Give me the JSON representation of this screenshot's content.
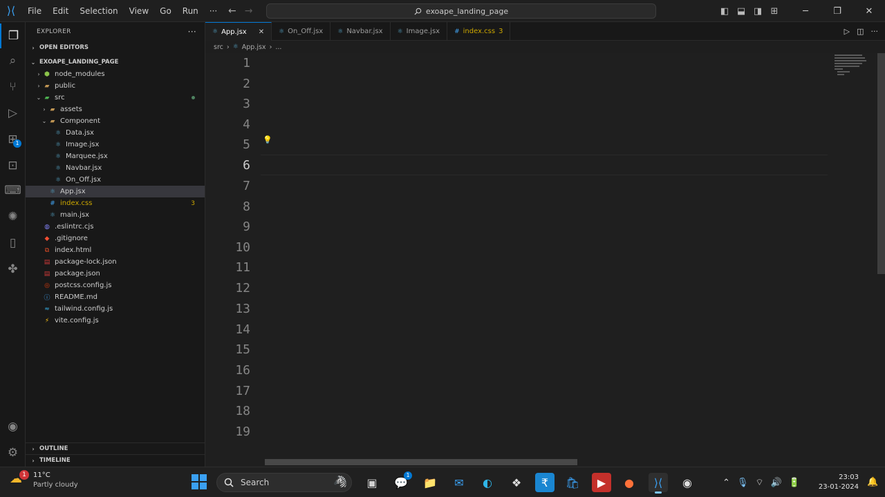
{
  "menu": [
    "File",
    "Edit",
    "Selection",
    "View",
    "Go",
    "Run",
    "···"
  ],
  "command_center": "exoape_landing_page",
  "explorer": {
    "title": "EXPLORER",
    "open_editors": "OPEN EDITORS",
    "project": "EXOAPE_LANDING_PAGE",
    "tree": [
      {
        "label": "node_modules",
        "depth": 1,
        "kind": "folder",
        "twisty": "›",
        "icon": "node"
      },
      {
        "label": "public",
        "depth": 1,
        "kind": "folder",
        "twisty": "›",
        "icon": "folder"
      },
      {
        "label": "src",
        "depth": 1,
        "kind": "folder",
        "twisty": "⌄",
        "icon": "folder-src",
        "modified": true
      },
      {
        "label": "assets",
        "depth": 2,
        "kind": "folder",
        "twisty": "›",
        "icon": "folder"
      },
      {
        "label": "Component",
        "depth": 2,
        "kind": "folder",
        "twisty": "⌄",
        "icon": "folder"
      },
      {
        "label": "Data.jsx",
        "depth": 3,
        "kind": "file",
        "icon": "jsx"
      },
      {
        "label": "Image.jsx",
        "depth": 3,
        "kind": "file",
        "icon": "jsx"
      },
      {
        "label": "Marquee.jsx",
        "depth": 3,
        "kind": "file",
        "icon": "jsx"
      },
      {
        "label": "Navbar.jsx",
        "depth": 3,
        "kind": "file",
        "icon": "jsx"
      },
      {
        "label": "On_Off.jsx",
        "depth": 3,
        "kind": "file",
        "icon": "jsx"
      },
      {
        "label": "App.jsx",
        "depth": 2,
        "kind": "file",
        "icon": "jsx",
        "selected": true
      },
      {
        "label": "index.css",
        "depth": 2,
        "kind": "file",
        "icon": "css",
        "badge": "3",
        "warn": true
      },
      {
        "label": "main.jsx",
        "depth": 2,
        "kind": "file",
        "icon": "jsx"
      },
      {
        "label": ".eslintrc.cjs",
        "depth": 1,
        "kind": "file",
        "icon": "eslint"
      },
      {
        "label": ".gitignore",
        "depth": 1,
        "kind": "file",
        "icon": "git"
      },
      {
        "label": "index.html",
        "depth": 1,
        "kind": "file",
        "icon": "html"
      },
      {
        "label": "package-lock.json",
        "depth": 1,
        "kind": "file",
        "icon": "npm"
      },
      {
        "label": "package.json",
        "depth": 1,
        "kind": "file",
        "icon": "npm"
      },
      {
        "label": "postcss.config.js",
        "depth": 1,
        "kind": "file",
        "icon": "postcss"
      },
      {
        "label": "README.md",
        "depth": 1,
        "kind": "file",
        "icon": "info"
      },
      {
        "label": "tailwind.config.js",
        "depth": 1,
        "kind": "file",
        "icon": "tailwind"
      },
      {
        "label": "vite.config.js",
        "depth": 1,
        "kind": "file",
        "icon": "vite"
      }
    ],
    "outline": "OUTLINE",
    "timeline": "TIMELINE"
  },
  "tabs": [
    {
      "label": "App.jsx",
      "active": true,
      "close": "✕"
    },
    {
      "label": "On_Off.jsx"
    },
    {
      "label": "Navbar.jsx"
    },
    {
      "label": "Image.jsx"
    },
    {
      "label": "index.css",
      "badge": "3",
      "css": true
    }
  ],
  "breadcrumb": {
    "folder": "src",
    "sep": "›",
    "file": "App.jsx",
    "more": "..."
  },
  "editor": {
    "current_line": 6,
    "line_numbers": [
      "1",
      "2",
      "3",
      "4",
      "5",
      "6",
      "7",
      "8",
      "9",
      "10",
      "11",
      "12",
      "13",
      "14",
      "15",
      "16",
      "17",
      "18",
      "19"
    ]
  },
  "taskbar": {
    "weather_temp": "11°C",
    "weather_desc": "Partly cloudy",
    "weather_badge": "1",
    "search": "Search",
    "time": "23:03",
    "date": "23-01-2024",
    "teams_badge": "1"
  },
  "colors": {
    "accent": "#0078d4",
    "editor_bg": "#1f1f1f",
    "sidebar_bg": "#181818"
  }
}
